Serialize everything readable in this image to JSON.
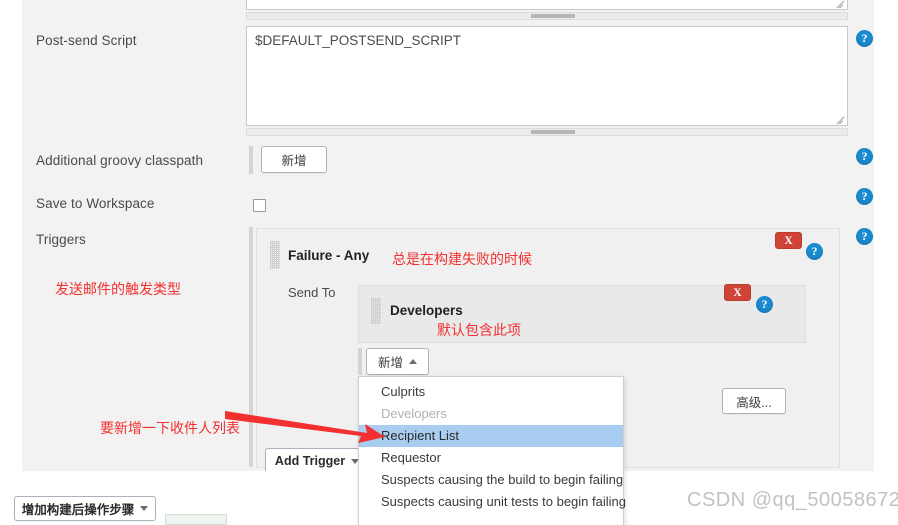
{
  "form": {
    "rows": [
      {
        "label": "Post-send Script"
      },
      {
        "label": "Additional groovy classpath"
      },
      {
        "label": "Save to Workspace"
      },
      {
        "label": "Triggers"
      }
    ],
    "postsend_script_value": "$DEFAULT_POSTSEND_SCRIPT",
    "groovy_classpath_add_label": "新增",
    "save_to_workspace_checked": false
  },
  "triggers": {
    "trigger_title": "Failure - Any",
    "send_to_label": "Send To",
    "recipient_title": "Developers",
    "add_recipient_label": "新增",
    "advanced_label": "高级...",
    "add_trigger_label": "Add Trigger",
    "delete_label": "X"
  },
  "dropdown": {
    "items": [
      {
        "label": "Culprits",
        "state": "normal"
      },
      {
        "label": "Developers",
        "state": "disabled"
      },
      {
        "label": "Recipient List",
        "state": "selected"
      },
      {
        "label": "Requestor",
        "state": "normal"
      },
      {
        "label": "Suspects causing the build to begin failing",
        "state": "normal"
      },
      {
        "label": "Suspects causing unit tests to begin failing",
        "state": "normal"
      }
    ]
  },
  "footer": {
    "add_post_build_step_label": "增加构建后操作步骤"
  },
  "annotations": [
    {
      "text": "总是在构建失败的时候"
    },
    {
      "text": "发送邮件的触发类型"
    },
    {
      "text": "默认包含此项"
    },
    {
      "text": "要新增一下收件人列表"
    }
  ],
  "watermark": {
    "text": "CSDN @qq_50058672"
  },
  "icons": {
    "help": "?",
    "caret_down": "▾",
    "caret_up": "▴"
  },
  "colors": {
    "accent_blue": "#1b8bd0",
    "danger_red": "#cf4436",
    "annotation_red": "#f2302f",
    "selection_blue": "#a8cdf0",
    "page_bg": "#f2f2f2"
  }
}
